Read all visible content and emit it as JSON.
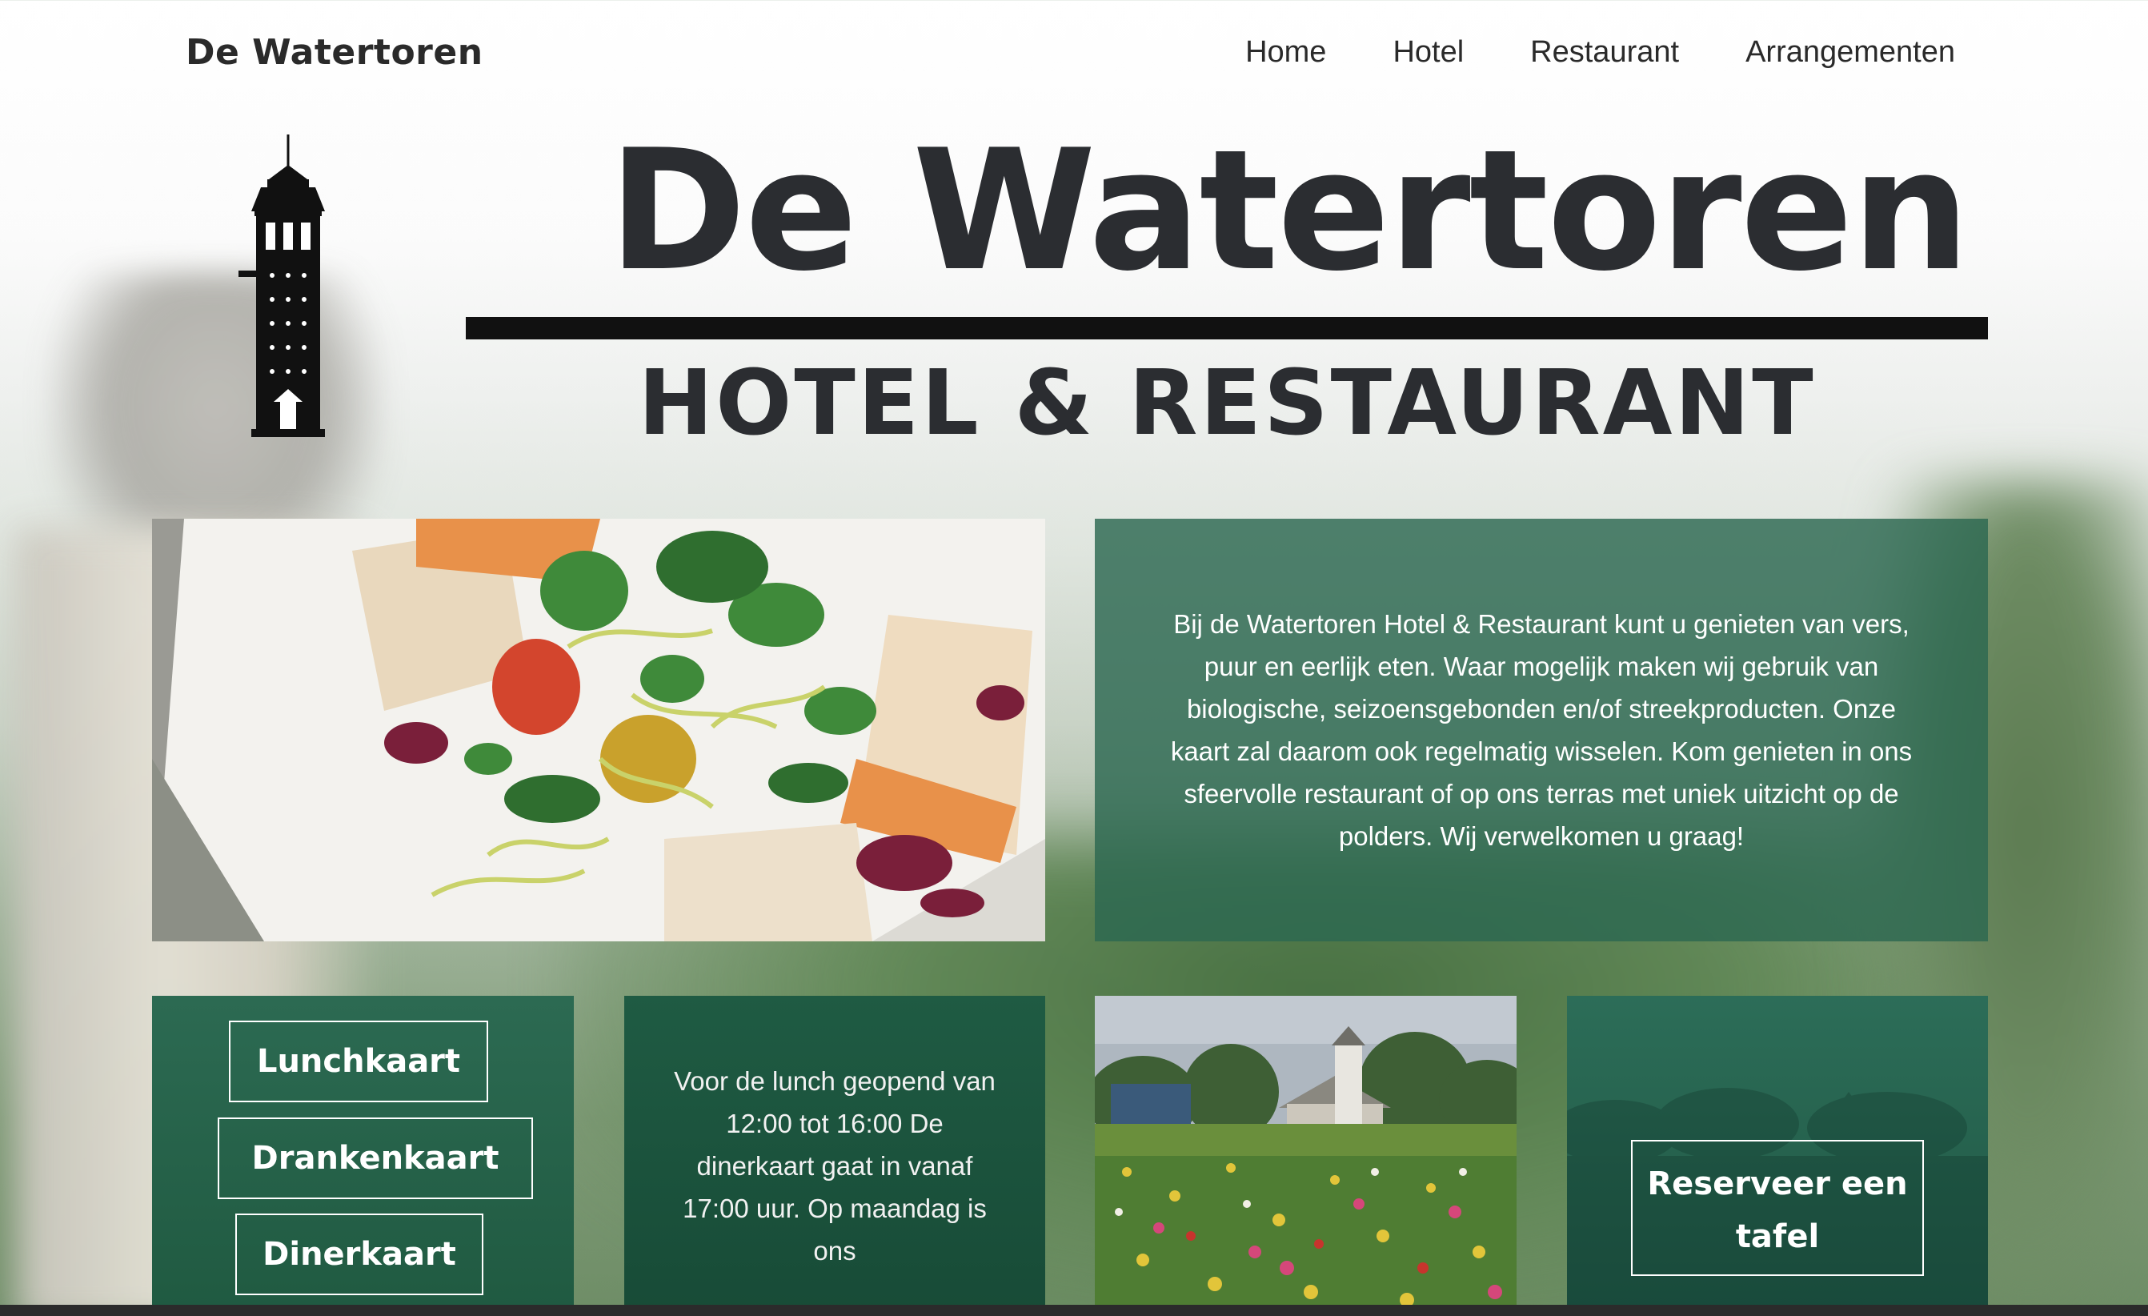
{
  "nav": {
    "brand": "De Watertoren",
    "links": [
      "Home",
      "Hotel",
      "Restaurant",
      "Arrangementen"
    ]
  },
  "hero": {
    "title": "De Watertoren",
    "subtitle": "HOTEL & RESTAURANT"
  },
  "intro": {
    "text": "Bij de Watertoren Hotel & Restaurant kunt u genieten van vers, puur en eerlijk eten. Waar mogelijk maken wij gebruik van biologische, seizoensgebonden en/of streekproducten. Onze kaart zal daarom ook regelmatig wisselen. Kom genieten in ons sfeervolle restaurant of op ons terras met uniek uitzicht op de polders. Wij verwelkomen u graag!"
  },
  "menus": {
    "buttons": [
      "Lunchkaart",
      "Drankenkaart",
      "Dinerkaart"
    ]
  },
  "hours": {
    "text": "Voor de lunch geopend van 12:00 tot 16:00 De dinerkaart gaat in vanaf 17:00 uur. Op maandag is ons"
  },
  "reserve": {
    "label": "Reserveer een tafel"
  },
  "colors": {
    "panel_green": "#2c6850",
    "text_dark": "#2b2d31"
  },
  "icons": {
    "tower": "water-tower-icon"
  }
}
